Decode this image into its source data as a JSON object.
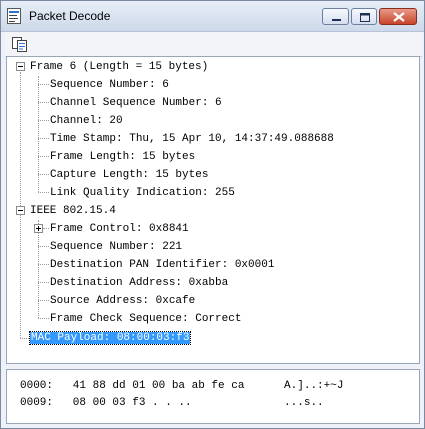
{
  "window": {
    "title": "Packet Decode"
  },
  "toolbar": {
    "copy_icon": "copy-icon"
  },
  "tree": {
    "frame": {
      "label": "Frame 6 (Length = 15 bytes)",
      "children": [
        "Sequence Number: 6",
        "Channel Sequence Number: 6",
        "Channel: 20",
        "Time Stamp: Thu, 15 Apr 10, 14:37:49.088688",
        "Frame Length: 15 bytes",
        "Capture Length: 15 bytes",
        "Link Quality Indication: 255"
      ]
    },
    "ieee": {
      "label": "IEEE 802.15.4",
      "children": [
        "Frame Control: 0x8841",
        "Sequence Number: 221",
        "Destination PAN Identifier: 0x0001",
        "Destination Address: 0xabba",
        "Source Address: 0xcafe",
        "Frame Check Sequence: Correct"
      ]
    },
    "payload": {
      "label": "MAC Payload: 08:00:03:f3"
    }
  },
  "hex": {
    "lines": [
      "0000:   41 88 dd 01 00 ba ab fe ca      A.]..:+~J",
      "0009:   08 00 03 f3 . . ..              ...s.."
    ]
  }
}
